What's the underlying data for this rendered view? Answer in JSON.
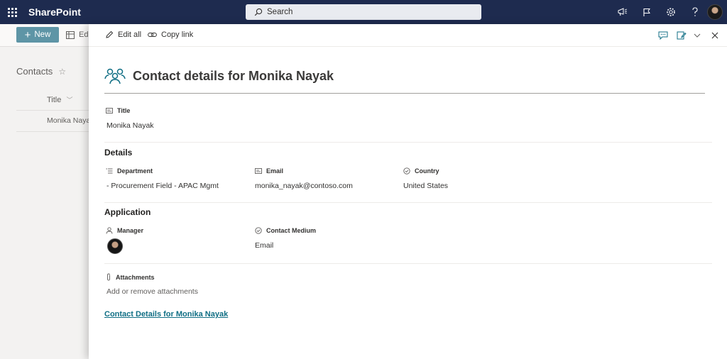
{
  "suite": {
    "brand": "SharePoint",
    "search_placeholder": "Search"
  },
  "background": {
    "new_label": "New",
    "edit_label": "Edi",
    "list_title": "Contacts",
    "column_title": "Title",
    "row_value": "Monika Nayak"
  },
  "panel": {
    "toolbar": {
      "edit_all": "Edit all",
      "copy_link": "Copy link"
    },
    "heading": "Contact details for Monika Nayak",
    "fields": {
      "title_label": "Title",
      "title_value": "Monika Nayak"
    },
    "details": {
      "section": "Details",
      "department_label": "Department",
      "department_value": "- Procurement Field - APAC Mgmt",
      "email_label": "Email",
      "email_value": "monika_nayak@contoso.com",
      "country_label": "Country",
      "country_value": "United States"
    },
    "application": {
      "section": "Application",
      "manager_label": "Manager",
      "contact_medium_label": "Contact Medium",
      "contact_medium_value": "Email"
    },
    "attachments": {
      "label": "Attachments",
      "placeholder": "Add or remove attachments"
    },
    "link_text": "Contact Details for Monika Nayak"
  },
  "colors": {
    "suitebar": "#1e2b4f",
    "accent": "#0f6e84",
    "new_button": "#5e95a6"
  }
}
